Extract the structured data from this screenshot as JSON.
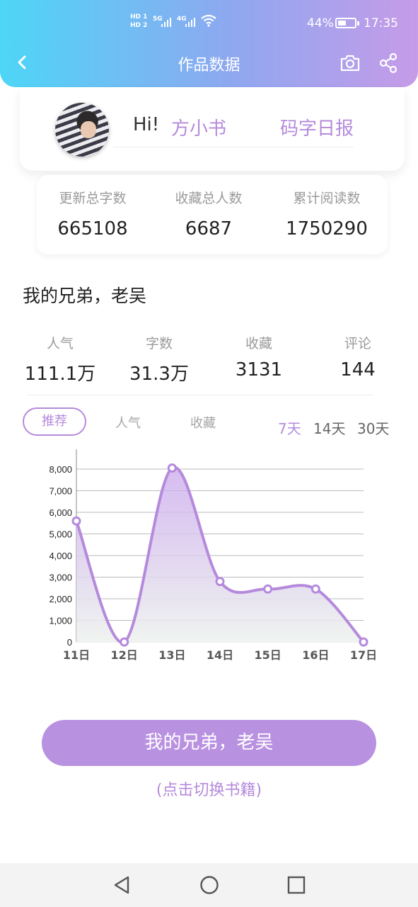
{
  "status_bar": {
    "hd1": "HD 1",
    "hd2": "HD 2",
    "net1": "5G",
    "net2": "4G",
    "battery": "44%",
    "time": "17:35"
  },
  "header": {
    "title": "作品数据",
    "back_icon": "chevron-left-icon",
    "camera_icon": "camera-icon",
    "share_icon": "share-icon"
  },
  "profile": {
    "greeting": "Hi!",
    "name": "方小书",
    "daily_report": "码字日报"
  },
  "totals": [
    {
      "label": "更新总字数",
      "value": "665108"
    },
    {
      "label": "收藏总人数",
      "value": "6687"
    },
    {
      "label": "累计阅读数",
      "value": "1750290"
    }
  ],
  "book": {
    "title": "我的兄弟，老吴",
    "stats": [
      {
        "label": "人气",
        "value": "111.1万"
      },
      {
        "label": "字数",
        "value": "31.3万"
      },
      {
        "label": "收藏",
        "value": "3131"
      },
      {
        "label": "评论",
        "value": "144"
      }
    ]
  },
  "tabs": {
    "items": [
      "推荐",
      "人气",
      "收藏"
    ],
    "active": 0
  },
  "ranges": {
    "items": [
      "7天",
      "14天",
      "30天"
    ],
    "active": 0
  },
  "chart_data": {
    "type": "area",
    "x": [
      "11日",
      "12日",
      "13日",
      "14日",
      "15日",
      "16日",
      "17日"
    ],
    "series": [
      {
        "values": [
          5600,
          0,
          8050,
          2800,
          2450,
          2450,
          0
        ]
      }
    ],
    "y_ticks": [
      "0",
      "1,000",
      "2,000",
      "3,000",
      "4,000",
      "5,000",
      "6,000",
      "7,000",
      "8,000"
    ],
    "ylim": [
      0,
      8000
    ],
    "grid": true,
    "color": "#b58adc"
  },
  "footer": {
    "switch_button": "我的兄弟，老吴",
    "switch_hint": "(点击切换书籍)"
  },
  "navbar": {
    "back_icon": "triangle-back-icon",
    "home_icon": "circle-home-icon",
    "recents_icon": "square-recents-icon"
  }
}
